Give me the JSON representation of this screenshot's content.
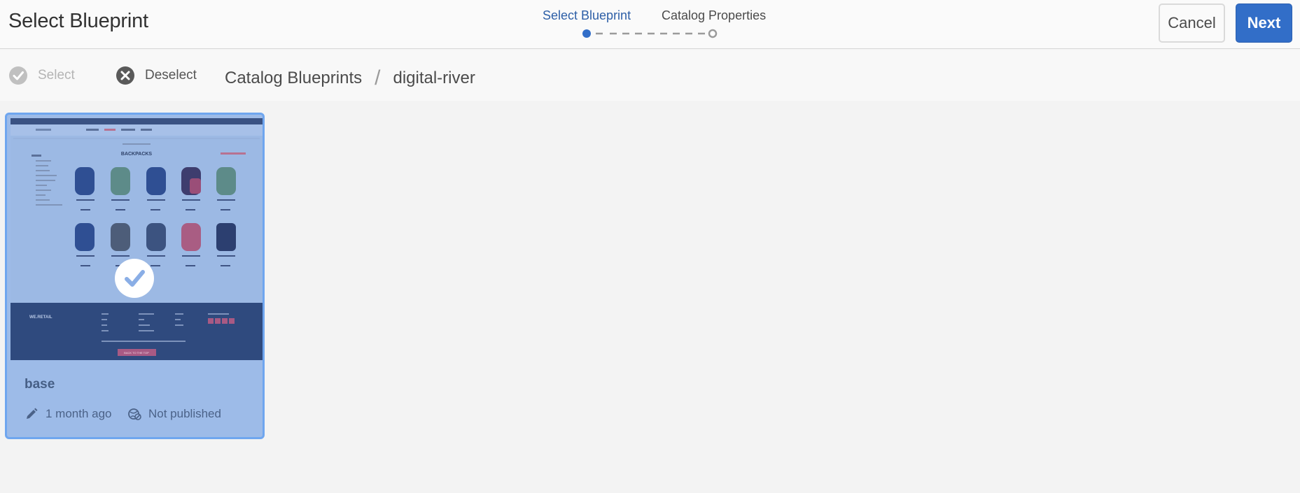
{
  "header": {
    "title": "Select Blueprint",
    "steps": [
      {
        "label": "Select Blueprint",
        "active": true
      },
      {
        "label": "Catalog Properties",
        "active": false
      }
    ],
    "cancel_label": "Cancel",
    "next_label": "Next",
    "accent_color": "#326ec8"
  },
  "actionbar": {
    "select_label": "Select",
    "select_icon": "check-circle-icon",
    "deselect_label": "Deselect",
    "deselect_icon": "close-circle-icon",
    "breadcrumb": [
      "Catalog Blueprints",
      "digital-river"
    ]
  },
  "cards": [
    {
      "title": "base",
      "selected": true,
      "modified": "1 month ago",
      "modified_icon": "pencil-icon",
      "status": "Not published",
      "status_icon": "globe-off-icon",
      "thumbnail": {
        "heading": "BACKPACKS",
        "logo": "WE.RETAIL",
        "footer_button": "BACK TO THE TOP"
      }
    }
  ]
}
